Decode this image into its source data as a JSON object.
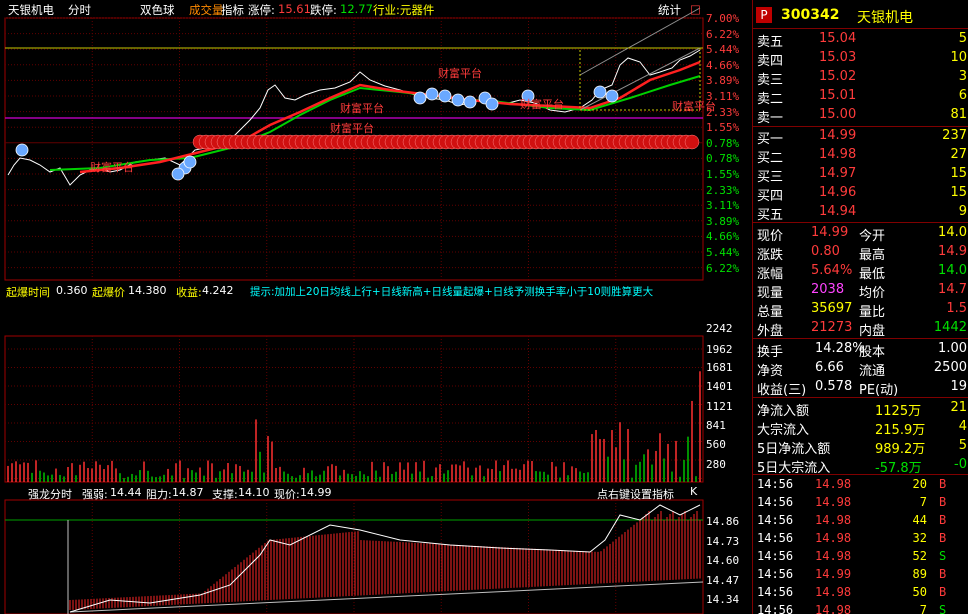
{
  "header": {
    "stock_name": "天银机电",
    "mode": "分时",
    "indicator_a": "双色球",
    "indicator_b": "成交量",
    "indicator_c": "指标",
    "limit_up_label": "涨停:",
    "limit_up_value": "15.61",
    "limit_down_label": "跌停:",
    "limit_down_value": "12.77",
    "industry": "行业:元器件",
    "stats_button": "统计"
  },
  "price_axis": {
    "right_labels_top": [
      "7.00%",
      "6.22%",
      "5.44%",
      "4.66%",
      "3.89%",
      "3.11%",
      "2.33%",
      "1.55%",
      "0.78%",
      "0.78%",
      "1.55%",
      "2.33%",
      "3.11%",
      "3.89%",
      "4.66%",
      "5.44%",
      "6.22%"
    ],
    "volume_labels": [
      "2242",
      "1962",
      "1681",
      "1401",
      "1121",
      "841",
      "560",
      "280"
    ],
    "lower_labels": [
      "14.86",
      "14.73",
      "14.60",
      "14.47",
      "14.34"
    ]
  },
  "annotations": {
    "platform_label": "财富平台"
  },
  "info_bar": {
    "burst_time_label": "起爆时间",
    "burst_time_value": "0.360",
    "burst_price_label": "起爆价",
    "burst_price_value": "14.380",
    "profit_label": "收益:",
    "profit_value": "4.242",
    "hint": "提示:加加上20日均线上行+日线新高+日线量起爆+日线予测换手率小于10则胜算更大"
  },
  "lower_panel": {
    "title": "强龙分时",
    "strength_label": "强弱:",
    "strength_value": "14.44",
    "resistance_label": "阻力:",
    "resistance_value": "14.87",
    "support_label": "支撑:",
    "support_value": "14.10",
    "price_label": "现价:",
    "price_value": "14.99",
    "settings_hint": "点右键设置指标"
  },
  "quote": {
    "code": "300342",
    "name": "天银机电",
    "sell": [
      {
        "label": "卖五",
        "price": "15.04",
        "vol": "5"
      },
      {
        "label": "卖四",
        "price": "15.03",
        "vol": "10"
      },
      {
        "label": "卖三",
        "price": "15.02",
        "vol": "3"
      },
      {
        "label": "卖二",
        "price": "15.01",
        "vol": "6"
      },
      {
        "label": "卖一",
        "price": "15.00",
        "vol": "81"
      }
    ],
    "buy": [
      {
        "label": "买一",
        "price": "14.99",
        "vol": "237"
      },
      {
        "label": "买二",
        "price": "14.98",
        "vol": "27"
      },
      {
        "label": "买三",
        "price": "14.97",
        "vol": "15"
      },
      {
        "label": "买四",
        "price": "14.96",
        "vol": "15"
      },
      {
        "label": "买五",
        "price": "14.94",
        "vol": "9"
      }
    ],
    "stats": [
      {
        "l1": "现价",
        "v1": "14.99",
        "l2": "今开",
        "v2": "14.0"
      },
      {
        "l1": "涨跌",
        "v1": "0.80",
        "l2": "最高",
        "v2": "14.9"
      },
      {
        "l1": "涨幅",
        "v1": "5.64%",
        "l2": "最低",
        "v2": "14.0"
      },
      {
        "l1": "现量",
        "v1": "2038",
        "l2": "均价",
        "v2": "14.7"
      },
      {
        "l1": "总量",
        "v1": "35697",
        "l2": "量比",
        "v2": "1.5"
      },
      {
        "l1": "外盘",
        "v1": "21273",
        "l2": "内盘",
        "v2": "1442"
      }
    ],
    "stats2": [
      {
        "l1": "换手",
        "v1": "14.28%",
        "l2": "股本",
        "v2": "1.00"
      },
      {
        "l1": "净资",
        "v1": "6.66",
        "l2": "流通",
        "v2": "2500"
      },
      {
        "l1": "收益(三)",
        "v1": "0.578",
        "l2": "PE(动)",
        "v2": "19"
      }
    ],
    "flows": [
      {
        "label": "净流入额",
        "value": "1125万",
        "extra": "21"
      },
      {
        "label": "大宗流入",
        "value": "215.9万",
        "extra": "4"
      },
      {
        "label": "5日净流入额",
        "value": "989.2万",
        "extra": "5"
      },
      {
        "label": "5日大宗流入",
        "value": "-57.8万",
        "extra": "-0"
      }
    ],
    "ticks": [
      {
        "time": "14:56",
        "price": "14.98",
        "vol": "20",
        "side": "B"
      },
      {
        "time": "14:56",
        "price": "14.98",
        "vol": "7",
        "side": "B"
      },
      {
        "time": "14:56",
        "price": "14.98",
        "vol": "44",
        "side": "B"
      },
      {
        "time": "14:56",
        "price": "14.98",
        "vol": "32",
        "side": "B"
      },
      {
        "time": "14:56",
        "price": "14.98",
        "vol": "52",
        "side": "S"
      },
      {
        "time": "14:56",
        "price": "14.99",
        "vol": "89",
        "side": "B"
      },
      {
        "time": "14:56",
        "price": "14.98",
        "vol": "50",
        "side": "B"
      },
      {
        "time": "14:56",
        "price": "14.98",
        "vol": "7",
        "side": "S"
      }
    ]
  },
  "colors": {
    "up": "#ff3b3b",
    "down": "#00e000",
    "grid": "#800000",
    "price_line": "#ffffff",
    "avg_line": "#ffff00"
  }
}
